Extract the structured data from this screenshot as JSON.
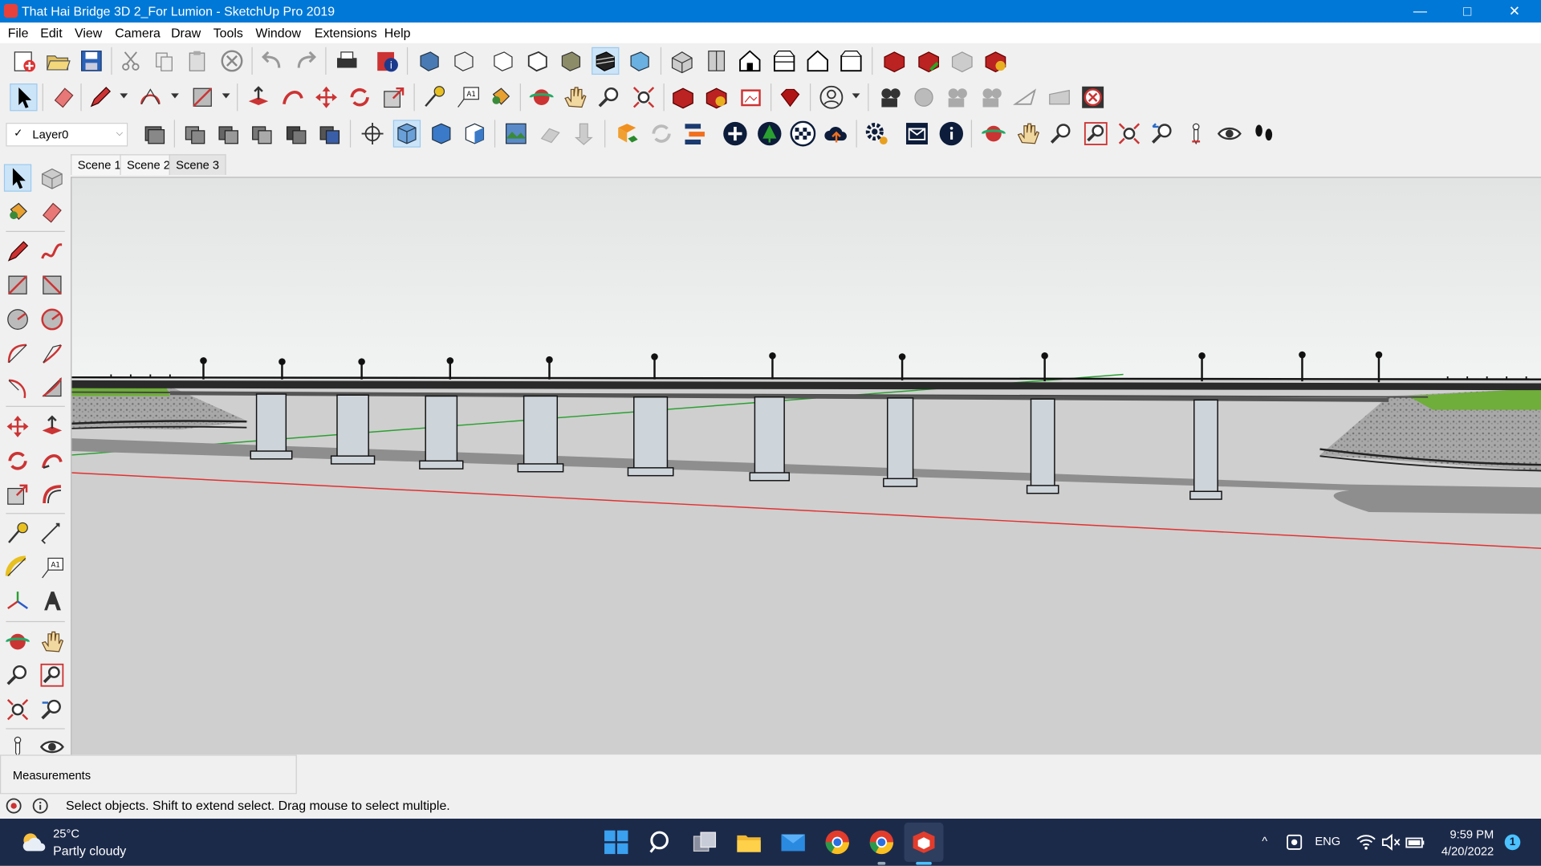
{
  "window": {
    "title": "That Hai Bridge 3D 2_For Lumion - SketchUp Pro 2019",
    "controls": {
      "minimize": "—",
      "maximize": "□",
      "close": "✕"
    }
  },
  "menu": [
    "File",
    "Edit",
    "View",
    "Camera",
    "Draw",
    "Tools",
    "Window",
    "Extensions",
    "Help"
  ],
  "layer": {
    "check": "✓",
    "name": "Layer0",
    "arrow": "⌵"
  },
  "scenes": [
    "Scene 1",
    "Scene 2",
    "Scene 3"
  ],
  "measurements": {
    "label": "Measurements"
  },
  "status": {
    "text": "Select objects. Shift to extend select. Drag mouse to select multiple."
  },
  "weather": {
    "temp": "25°C",
    "desc": "Partly cloudy"
  },
  "tray": {
    "lang": "ENG",
    "chevron": "^"
  },
  "clock": {
    "time": "9:59 PM",
    "date": "4/20/2022"
  },
  "notifications": {
    "count": "1"
  },
  "colors": {
    "titlebar": "#0078d7",
    "taskbar": "#1c2a4a",
    "sky_top": "#e6e8e8",
    "ground": "#d0d0d0",
    "red_axis": "#e23030",
    "green_axis": "#2aa030",
    "grass": "#6fae3a"
  }
}
